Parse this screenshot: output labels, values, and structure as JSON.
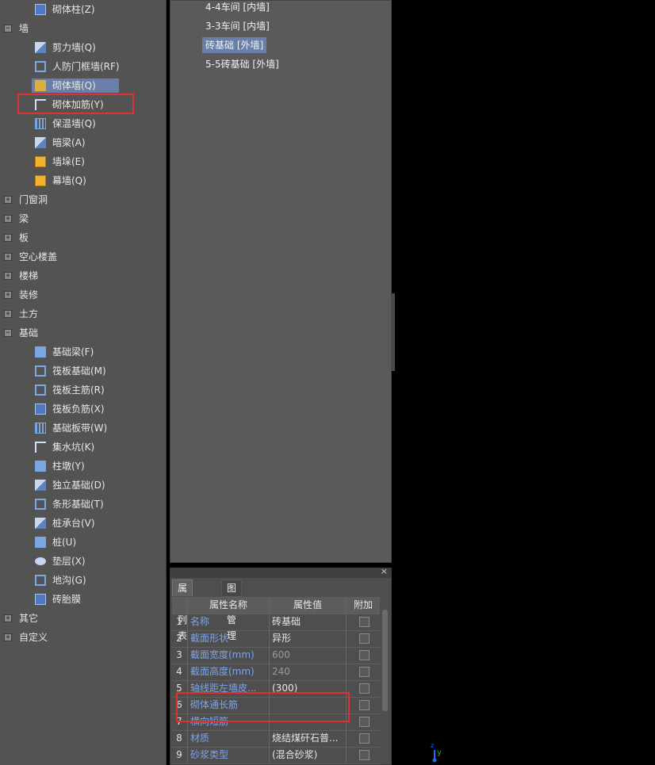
{
  "tree": {
    "items": [
      {
        "kind": "child",
        "label": "砌体柱(Z)",
        "icon": "masonry-column-icon",
        "ic": "ic-h"
      },
      {
        "kind": "group",
        "label": "墙",
        "expander": "−",
        "icon": "collapse-icon"
      },
      {
        "kind": "child",
        "label": "剪力墙(Q)",
        "icon": "shear-wall-icon",
        "ic": "ic-c"
      },
      {
        "kind": "child",
        "label": "人防门框墙(RF)",
        "icon": "civil-defense-door-frame-wall-icon",
        "ic": "ic-b"
      },
      {
        "kind": "child",
        "label": "砌体墙(Q)",
        "icon": "masonry-wall-icon",
        "ic": "ic-d",
        "selected": true
      },
      {
        "kind": "child",
        "label": "砌体加筋(Y)",
        "icon": "masonry-reinforcement-icon",
        "ic": "ic-g"
      },
      {
        "kind": "child",
        "label": "保温墙(Q)",
        "icon": "insulation-wall-icon",
        "ic": "ic-e"
      },
      {
        "kind": "child",
        "label": "暗梁(A)",
        "icon": "hidden-beam-icon",
        "ic": "ic-c"
      },
      {
        "kind": "child",
        "label": "墙垛(E)",
        "icon": "wall-pier-icon",
        "ic": "ic-f"
      },
      {
        "kind": "child",
        "label": "幕墙(Q)",
        "icon": "curtain-wall-icon",
        "ic": "ic-f"
      },
      {
        "kind": "group",
        "label": "门窗洞",
        "expander": "+",
        "icon": "expand-icon"
      },
      {
        "kind": "group",
        "label": "梁",
        "expander": "+",
        "icon": "expand-icon"
      },
      {
        "kind": "group",
        "label": "板",
        "expander": "+",
        "icon": "expand-icon"
      },
      {
        "kind": "group",
        "label": "空心楼盖",
        "expander": "+",
        "icon": "expand-icon"
      },
      {
        "kind": "group",
        "label": "楼梯",
        "expander": "+",
        "icon": "expand-icon"
      },
      {
        "kind": "group",
        "label": "装修",
        "expander": "+",
        "icon": "expand-icon"
      },
      {
        "kind": "group",
        "label": "土方",
        "expander": "+",
        "icon": "expand-icon"
      },
      {
        "kind": "group",
        "label": "基础",
        "expander": "−",
        "icon": "collapse-icon"
      },
      {
        "kind": "child",
        "label": "基础梁(F)",
        "icon": "foundation-beam-icon",
        "ic": "ic-a"
      },
      {
        "kind": "child",
        "label": "筏板基础(M)",
        "icon": "raft-foundation-icon",
        "ic": "ic-b"
      },
      {
        "kind": "child",
        "label": "筏板主筋(R)",
        "icon": "raft-main-rebar-icon",
        "ic": "ic-b"
      },
      {
        "kind": "child",
        "label": "筏板负筋(X)",
        "icon": "raft-negative-rebar-icon",
        "ic": "ic-h"
      },
      {
        "kind": "child",
        "label": "基础板带(W)",
        "icon": "foundation-strip-icon",
        "ic": "ic-e"
      },
      {
        "kind": "child",
        "label": "集水坑(K)",
        "icon": "sump-pit-icon",
        "ic": "ic-g"
      },
      {
        "kind": "child",
        "label": "柱墩(Y)",
        "icon": "column-pier-icon",
        "ic": "ic-a"
      },
      {
        "kind": "child",
        "label": "独立基础(D)",
        "icon": "isolated-foundation-icon",
        "ic": "ic-c"
      },
      {
        "kind": "child",
        "label": "条形基础(T)",
        "icon": "strip-foundation-icon",
        "ic": "ic-b"
      },
      {
        "kind": "child",
        "label": "桩承台(V)",
        "icon": "pile-cap-icon",
        "ic": "ic-c"
      },
      {
        "kind": "child",
        "label": "桩(U)",
        "icon": "pile-icon",
        "ic": "ic-a"
      },
      {
        "kind": "child",
        "label": "垫层(X)",
        "icon": "cushion-layer-icon",
        "ic": "ic-circle"
      },
      {
        "kind": "child",
        "label": "地沟(G)",
        "icon": "trench-icon",
        "ic": "ic-b"
      },
      {
        "kind": "child",
        "label": "砖胎膜",
        "icon": "brick-mould-icon",
        "ic": "ic-h"
      },
      {
        "kind": "group",
        "label": "其它",
        "expander": "+",
        "icon": "expand-icon"
      },
      {
        "kind": "group",
        "label": "自定义",
        "expander": "+",
        "icon": "expand-icon"
      }
    ]
  },
  "component_list": {
    "items": [
      {
        "label": "4-4车间 [内墙]"
      },
      {
        "label": "3-3车间 [内墙]"
      },
      {
        "label": "砖基础 [外墙]",
        "selected": true
      },
      {
        "label": "5-5砖基础 [外墙]"
      }
    ]
  },
  "properties": {
    "close_glyph": "×",
    "tabs": [
      {
        "label": "属性列表",
        "active": true
      },
      {
        "label": "图层管理",
        "active": false
      }
    ],
    "columns": {
      "name": "属性名称",
      "value": "属性值",
      "extra": "附加"
    },
    "rows": [
      {
        "num": "1",
        "name": "名称",
        "value": "砖基础",
        "dim": false
      },
      {
        "num": "2",
        "name": "截面形状",
        "value": "异形",
        "dim": false
      },
      {
        "num": "3",
        "name": "截面宽度(mm)",
        "value": "600",
        "dim": true
      },
      {
        "num": "4",
        "name": "截面高度(mm)",
        "value": "240",
        "dim": true
      },
      {
        "num": "5",
        "name": "轴线距左墙皮...",
        "value": "(300)",
        "dim": false
      },
      {
        "num": "6",
        "name": "砌体通长筋",
        "value": "",
        "dim": false
      },
      {
        "num": "7",
        "name": "横向短筋",
        "value": "",
        "dim": false
      },
      {
        "num": "8",
        "name": "材质",
        "value": "烧结煤矸石普...",
        "dim": false
      },
      {
        "num": "9",
        "name": "砂浆类型",
        "value": "(混合砂浆)",
        "dim": false
      }
    ]
  },
  "axis_gizmo": {
    "x_label": "z",
    "y_label": "y",
    "x_color": "#1e6cff",
    "y_color": "#1ec21e"
  }
}
